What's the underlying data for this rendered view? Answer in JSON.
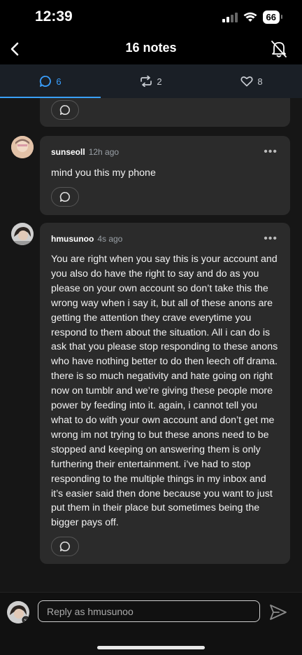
{
  "status_bar": {
    "time": "12:39",
    "battery": "66"
  },
  "header": {
    "title": "16 notes"
  },
  "tabs": [
    {
      "name": "replies",
      "count": "6",
      "icon": "comment-icon"
    },
    {
      "name": "reblogs",
      "count": "2",
      "icon": "reblog-icon"
    },
    {
      "name": "likes",
      "count": "8",
      "icon": "heart-icon"
    }
  ],
  "comments": [
    {
      "username": "sunseoll",
      "time": "12h ago",
      "text": "mind you this my phone"
    },
    {
      "username": "hmusunoo",
      "time": "4s ago",
      "text": "You are right when you say this is your account and you also do have the right to say and do as you please on your own account so don’t take this the wrong way when i say it, but all of these anons are getting the attention they crave everytime you respond to them about the situation. All i can do is ask that you please stop responding to these anons who have nothing better to do then leech off drama. there is so much negativity and hate going on right now on tumblr and we’re giving these people more power by feeding into it. again, i cannot tell you what to do with your own account and don’t get me wrong im not trying to but these anons need to be stopped and keeping on answering them is only furthering their entertainment. i’ve had to stop responding to the multiple things in my inbox and it’s easier said then done because you want to just put them in their place but sometimes being the bigger pays off."
    }
  ],
  "more_label": "•••",
  "reply_bar": {
    "placeholder": "Reply as hmusunoo"
  },
  "colors": {
    "accent": "#3aa0ff",
    "card": "#2b2b2b",
    "background": "#161616"
  }
}
